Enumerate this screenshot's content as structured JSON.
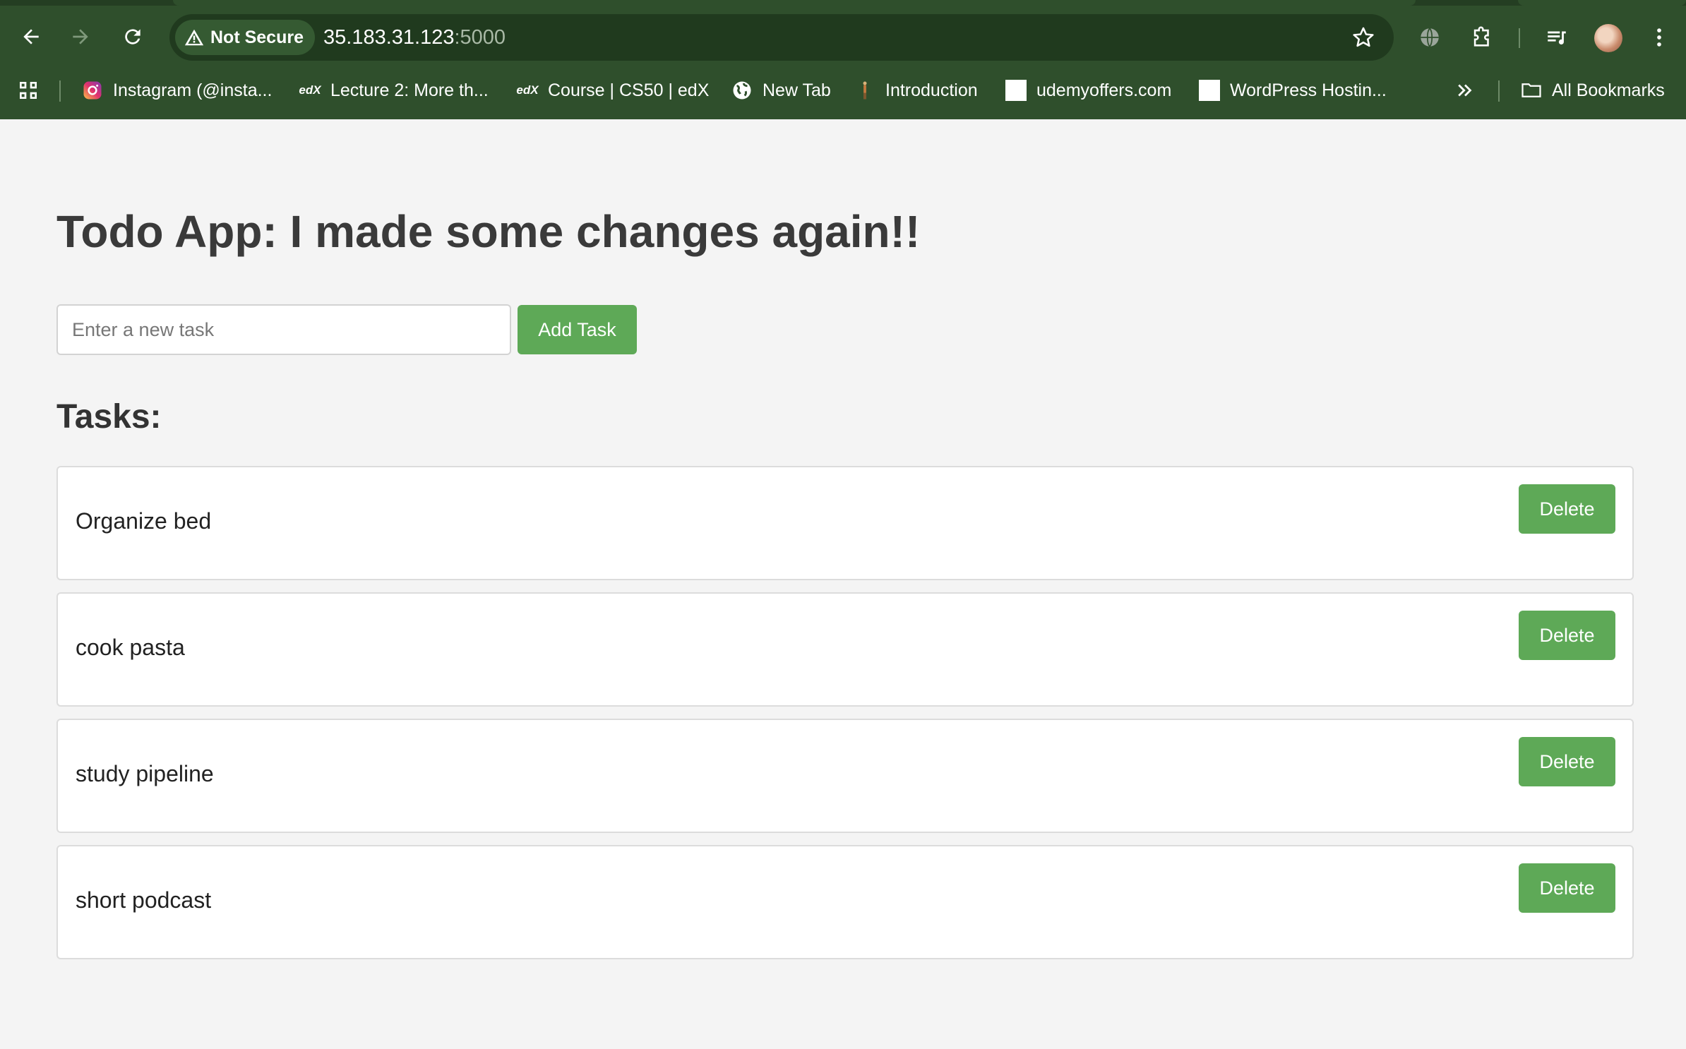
{
  "browser": {
    "security_chip": "Not Secure",
    "url_host": "35.183.31.123",
    "url_port": ":5000",
    "bookmarks": [
      {
        "label": "Instagram (@insta...",
        "icon": "instagram-icon"
      },
      {
        "label": "Lecture 2: More th...",
        "icon": "edx-icon"
      },
      {
        "label": "Course | CS50 | edX",
        "icon": "edx-icon"
      },
      {
        "label": "New Tab",
        "icon": "globe-icon"
      },
      {
        "label": "Introduction",
        "icon": "figure-icon"
      },
      {
        "label": "udemyoffers.com",
        "icon": "blank-page-icon"
      },
      {
        "label": "WordPress Hostin...",
        "icon": "blank-page-icon"
      }
    ],
    "all_bookmarks": "All Bookmarks"
  },
  "app": {
    "title": "Todo App: I made some changes again!!",
    "input_placeholder": "Enter a new task",
    "add_button": "Add Task",
    "tasks_heading": "Tasks:",
    "tasks": [
      {
        "text": "Organize bed",
        "delete_label": "Delete"
      },
      {
        "text": "cook pasta",
        "delete_label": "Delete"
      },
      {
        "text": "study pipeline",
        "delete_label": "Delete"
      },
      {
        "text": "short podcast",
        "delete_label": "Delete"
      }
    ]
  },
  "colors": {
    "chrome_bg": "#2f4f2c",
    "accent_green": "#5ea957",
    "page_bg": "#f4f4f4"
  }
}
